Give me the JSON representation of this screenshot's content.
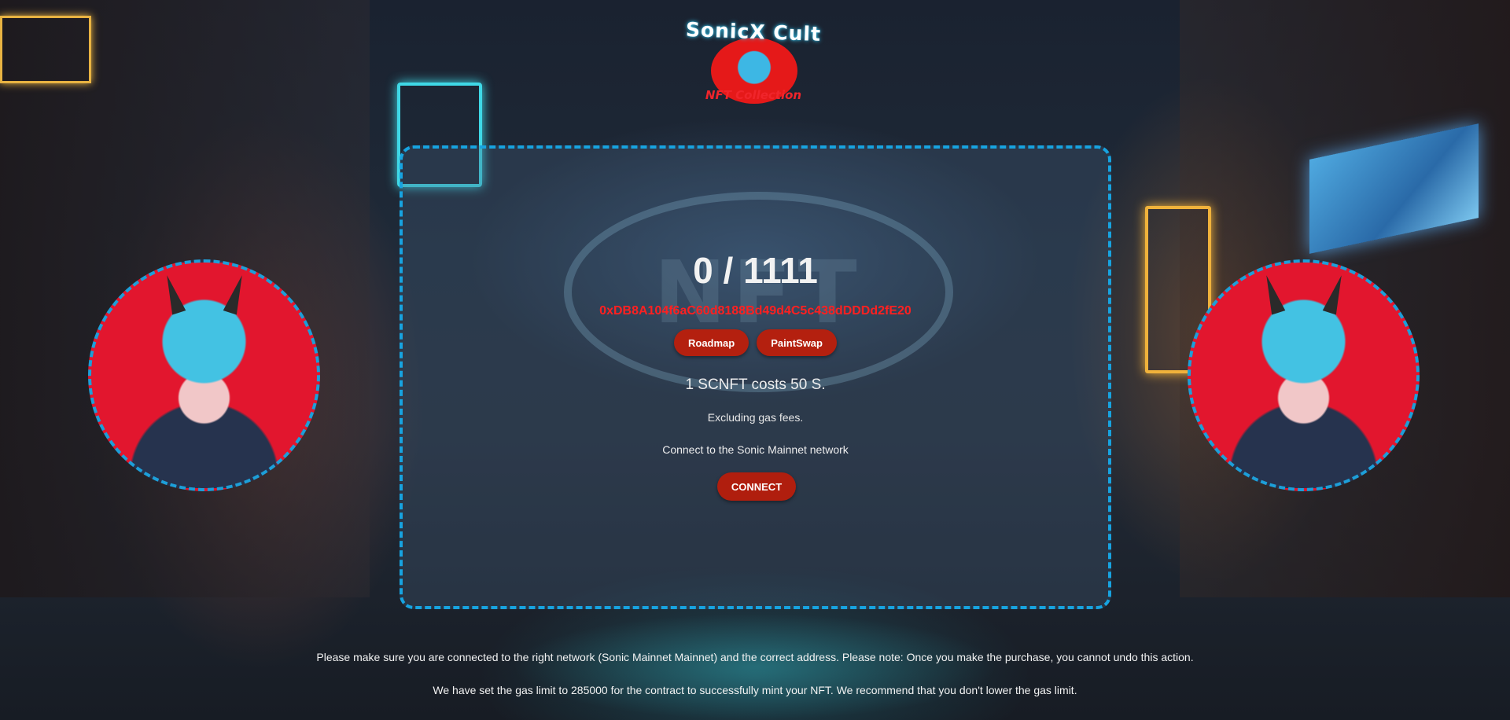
{
  "logo": {
    "title": "SonicX Cult",
    "subtitle": "NFT Collection"
  },
  "mint": {
    "counter": "0 / 1111",
    "contract_address": "0xDB8A104f6aC60d8188Bd49d4C5c438dDDDd2fE20",
    "roadmap_label": "Roadmap",
    "paintswap_label": "PaintSwap",
    "cost_text": "1 SCNFT costs 50 S.",
    "gas_text": "Excluding gas fees.",
    "network_text": "Connect to the Sonic Mainnet network",
    "connect_label": "CONNECT"
  },
  "notes": {
    "network_note": "Please make sure you are connected to the right network (Sonic Mainnet Mainnet) and the correct address. Please note: Once you make the purchase, you cannot undo this action.",
    "gas_note": "We have set the gas limit to 285000 for the contract to successfully mint your NFT. We recommend that you don't lower the gas limit."
  },
  "colors": {
    "accent_border": "#17a3e0",
    "button_red": "#b4200f",
    "address_red": "#ff2020"
  },
  "icons": {
    "logo_avatar": "anime-character-avatar",
    "side_avatar": "anime-character-avatar"
  }
}
